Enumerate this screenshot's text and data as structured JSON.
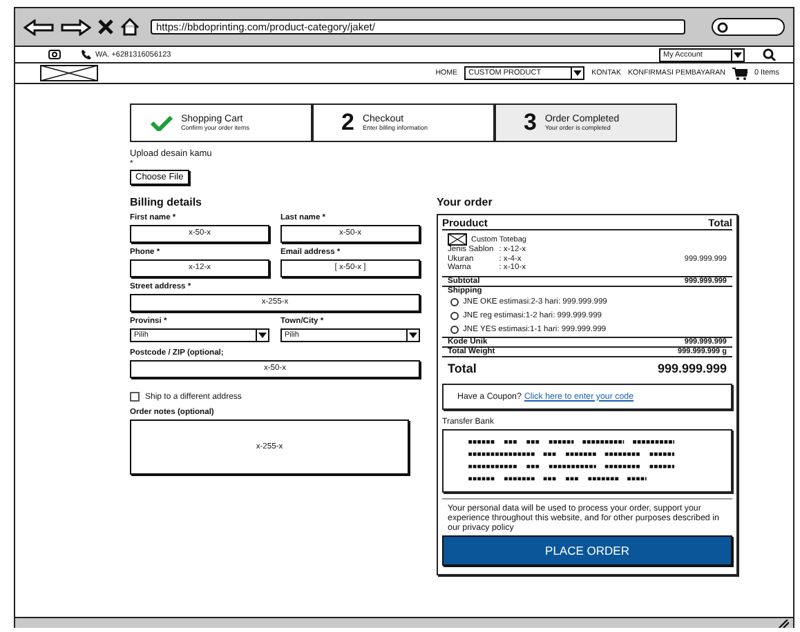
{
  "browser": {
    "url": "https://bbdoprinting.com/product-category/jaket/"
  },
  "topbar": {
    "phone": "WA. +6281316056123",
    "account": "My Account"
  },
  "nav": {
    "items": [
      {
        "kind": "link",
        "label": "HOME"
      },
      {
        "kind": "dropdown",
        "label": "CUSTOM PRODUCT"
      },
      {
        "kind": "link",
        "label": "KONTAK"
      },
      {
        "kind": "link",
        "label": "KONFIRMASI PEMBAYARAN"
      }
    ],
    "cart": "0 Items"
  },
  "steps": [
    {
      "kind": "done",
      "title": "Shopping Cart",
      "subtitle": "Confirm your order items",
      "selected": false
    },
    {
      "kind": "number",
      "number": "2",
      "title": "Checkout",
      "subtitle": "Enter billing information",
      "selected": false
    },
    {
      "kind": "number",
      "number": "3",
      "title": "Order Completed",
      "subtitle": "Your order is completed",
      "selected": true
    }
  ],
  "upload": {
    "label": "Upload desain kamu",
    "mark": "*",
    "button": "Choose File"
  },
  "billing": {
    "title": "Billing details",
    "rows": [
      [
        {
          "kind": "input",
          "label": "First name *",
          "value": "x-50-x"
        },
        {
          "kind": "input",
          "label": "Last name *",
          "value": "x-50-x"
        }
      ],
      [
        {
          "kind": "input",
          "label": "Phone *",
          "value": "x-12-x"
        },
        {
          "kind": "input",
          "label": "Email address *",
          "value": "[ x-50-x ]"
        }
      ],
      [
        {
          "kind": "input",
          "label": "Street address *",
          "value": "x-255-x"
        }
      ],
      [
        {
          "kind": "select",
          "label": "Provinsi *",
          "value": "Pilih"
        },
        {
          "kind": "select",
          "label": "Town/City *",
          "value": "Pilih"
        }
      ],
      [
        {
          "kind": "input",
          "label": "Postcode / ZIP (optional;",
          "value": "x-50-x"
        }
      ]
    ],
    "ship": {
      "label": "Ship to a different address",
      "checked": false
    },
    "notes": {
      "label": "Order notes (optional)",
      "value": "x-255-x"
    }
  },
  "order": {
    "title": "Your order",
    "header": [
      "Prouduct",
      "Total"
    ],
    "product": "Custom Totebag",
    "attributes": [
      {
        "name": "Jenis Sablon",
        "value": ": x-12-x"
      },
      {
        "name": "Ukuran",
        "value": ": x-4-x"
      },
      {
        "name": "Warna",
        "value": ": x-10-x"
      }
    ],
    "amount": "999.999.999",
    "subtotal": {
      "label": "Subtotal",
      "value": "999.999.999"
    },
    "shipping": {
      "label": "Shipping",
      "options": [
        {
          "label": "JNE OKE estimasi:2-3 hari: 999.999.999",
          "selected": false
        },
        {
          "label": "JNE reg estimasi:1-2 hari: 999.999.999",
          "selected": false
        },
        {
          "label": "JNE YES estimasi:1-1 hari: 999.999.999",
          "selected": false
        }
      ]
    },
    "kode_unik": {
      "label": "Kode Unik",
      "value": "999.999.999"
    },
    "weight": {
      "label": "Total Weight",
      "value": "999.999.999 g"
    },
    "total": {
      "label": "Total",
      "value": "999.999.999"
    },
    "coupon": {
      "text": "Have a Coupon?",
      "link": "Click here to enter your code"
    },
    "payment": {
      "label": "Transfer Bank"
    },
    "privacy": "Your personal data will be used to process your order, support your experience throughout this website, and for other purposes described in our privacy policy",
    "button": "PLACE ORDER"
  }
}
